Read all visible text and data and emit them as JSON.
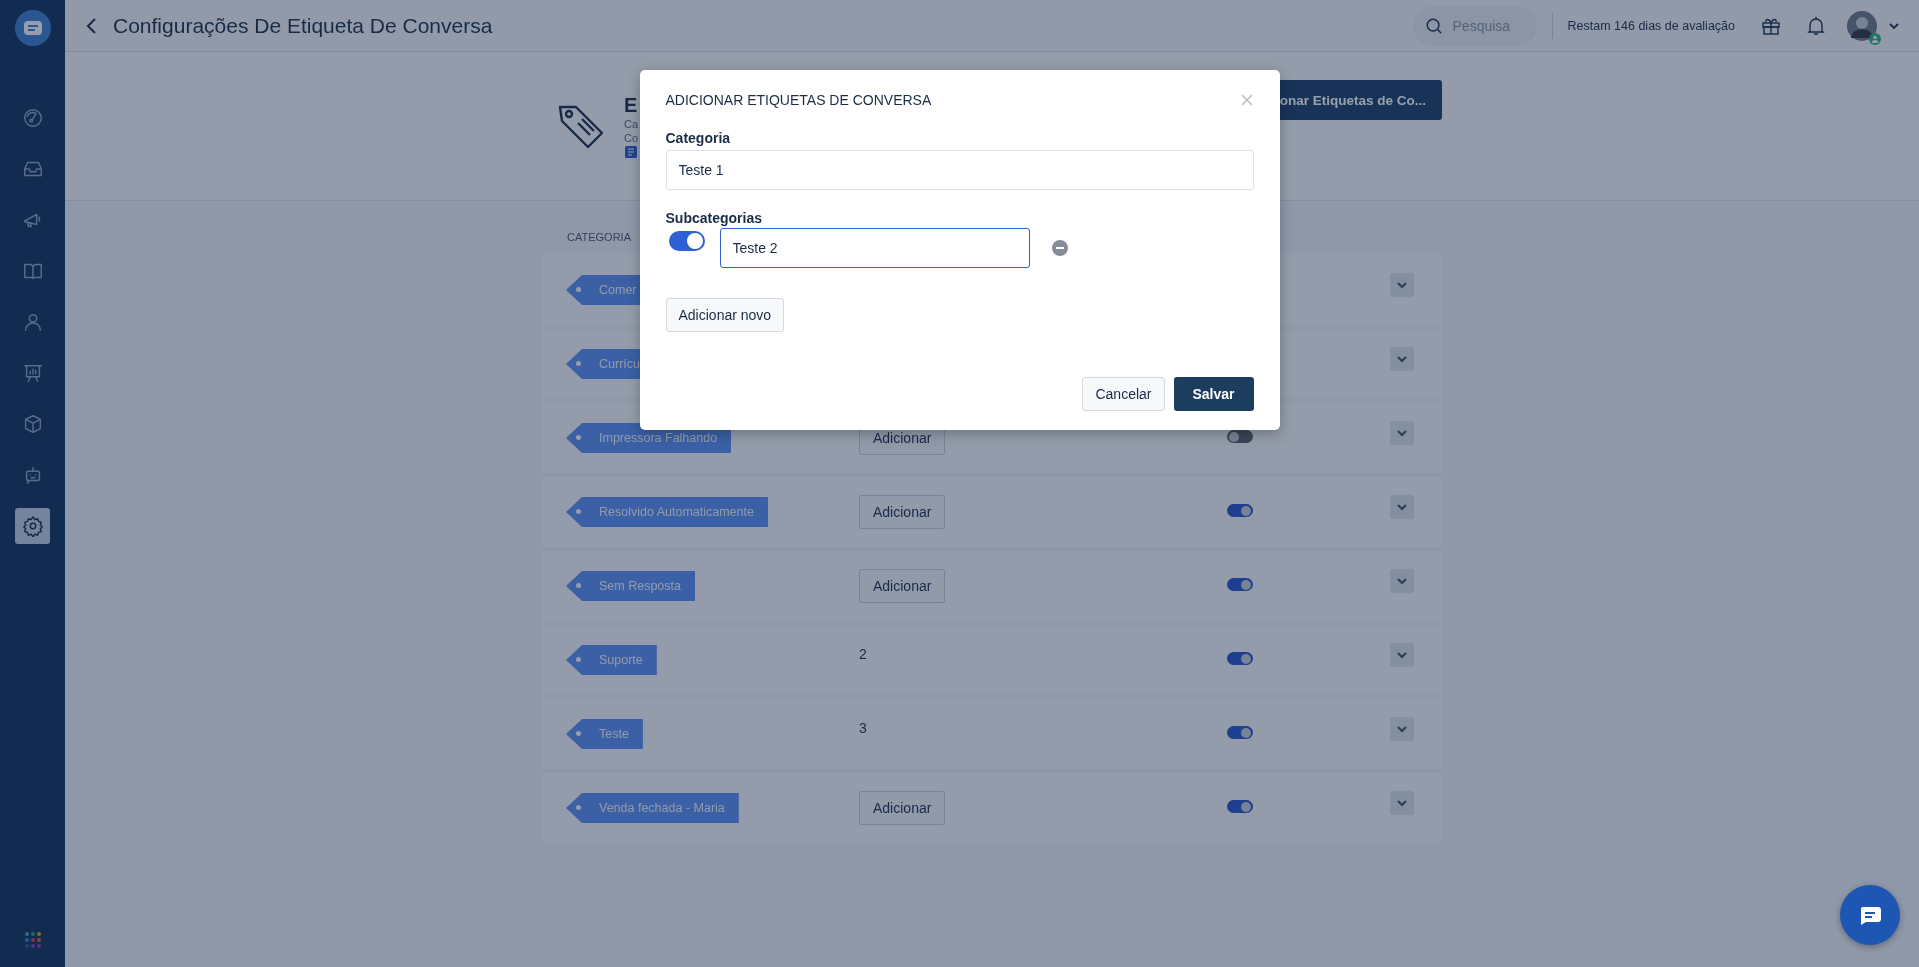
{
  "header": {
    "title": "Configurações De Etiqueta De Conversa",
    "search": {
      "placeholder": "Pesquisa"
    },
    "trial": "Restam 146 dias de avaliação"
  },
  "sidebar": {
    "items": [
      {
        "kind": "dashboard",
        "selected": false
      },
      {
        "kind": "inbox",
        "selected": false
      },
      {
        "kind": "megaphone",
        "selected": false
      },
      {
        "kind": "book",
        "selected": false
      },
      {
        "kind": "person",
        "selected": false
      },
      {
        "kind": "presentation",
        "selected": false
      },
      {
        "kind": "box",
        "selected": false
      },
      {
        "kind": "bot",
        "selected": false
      },
      {
        "kind": "settings",
        "selected": true
      }
    ]
  },
  "banner": {
    "title": "E",
    "lines": [
      "Ca",
      "Co"
    ],
    "button": "onar Etiquetas de Co..."
  },
  "table": {
    "columns": [
      "CATEGORIA"
    ],
    "rows": [
      {
        "tag": "Comer"
      },
      {
        "tag": "Currícu"
      },
      {
        "tag": "Impressora Falhando",
        "action": "Adicionar",
        "on": false
      },
      {
        "tag": "Resolvido Automaticamente",
        "action": "Adicionar",
        "on": true
      },
      {
        "tag": "Sem Resposta",
        "action": "Adicionar",
        "on": true
      },
      {
        "tag": "Suporte",
        "count": "2",
        "on": true
      },
      {
        "tag": "Teste",
        "count": "3",
        "on": true
      },
      {
        "tag": "Venda fechada - Maria",
        "action": "Adicionar",
        "on": true
      }
    ]
  },
  "modal": {
    "title": "ADICIONAR ETIQUETAS DE CONVERSA",
    "category_label": "Categoria",
    "category_value": "Teste 1",
    "subcategories_label": "Subcategorias",
    "subcategories": [
      {
        "value": "Teste 2",
        "on": true
      }
    ],
    "add_button": "Adicionar novo",
    "buttons": [
      "Cancelar",
      "Salvar"
    ]
  }
}
